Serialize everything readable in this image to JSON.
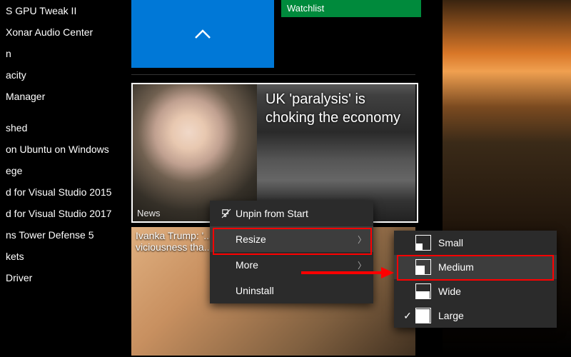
{
  "applist": [
    "S GPU Tweak II",
    "Xonar Audio Center",
    "n",
    "acity",
    "Manager",
    "",
    "shed",
    "on Ubuntu on Windows",
    "ege",
    "d for Visual Studio 2015",
    "d for Visual Studio 2017",
    "ns Tower Defense 5",
    "kets",
    "Driver"
  ],
  "tiles": {
    "green_label": "Watchlist",
    "news": {
      "label": "News",
      "headline": "UK 'paralysis' is choking the economy"
    },
    "secondary_caption": "Ivanka Trump: '... viciousness tha..."
  },
  "context_menu": {
    "unpin": "Unpin from Start",
    "resize": "Resize",
    "more": "More",
    "uninstall": "Uninstall"
  },
  "resize_menu": {
    "small": "Small",
    "medium": "Medium",
    "wide": "Wide",
    "large": "Large"
  }
}
